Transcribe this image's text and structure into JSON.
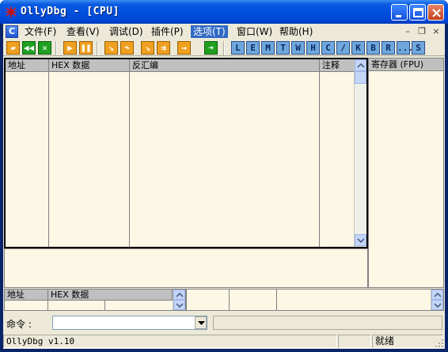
{
  "window": {
    "title": "OllyDbg - [CPU]"
  },
  "menu": [
    {
      "label": "文件(F)"
    },
    {
      "label": "查看(V)"
    },
    {
      "label": "调试(D)"
    },
    {
      "label": "插件(P)"
    },
    {
      "label": "选项(T)",
      "active": true
    },
    {
      "label": "窗口(W)"
    },
    {
      "label": "帮助(H)"
    }
  ],
  "toolbar": {
    "letters": [
      "L",
      "E",
      "M",
      "T",
      "W",
      "H",
      "C",
      "/",
      "K",
      "B",
      "R",
      "...",
      "S"
    ]
  },
  "disasm": {
    "headers": [
      "地址",
      "HEX 数据",
      "反汇编",
      "注释"
    ]
  },
  "registers": {
    "header": "寄存器 (FPU)"
  },
  "dump": {
    "headers": [
      "地址",
      "HEX 数据"
    ]
  },
  "command": {
    "label": "命令 :",
    "value": ""
  },
  "status": {
    "version": "OllyDbg v1.10",
    "state": "就绪"
  },
  "colors": {
    "title_blue": "#0050e0",
    "pane_bg": "#fdf7e6",
    "menu_highlight": "#316ac5"
  }
}
